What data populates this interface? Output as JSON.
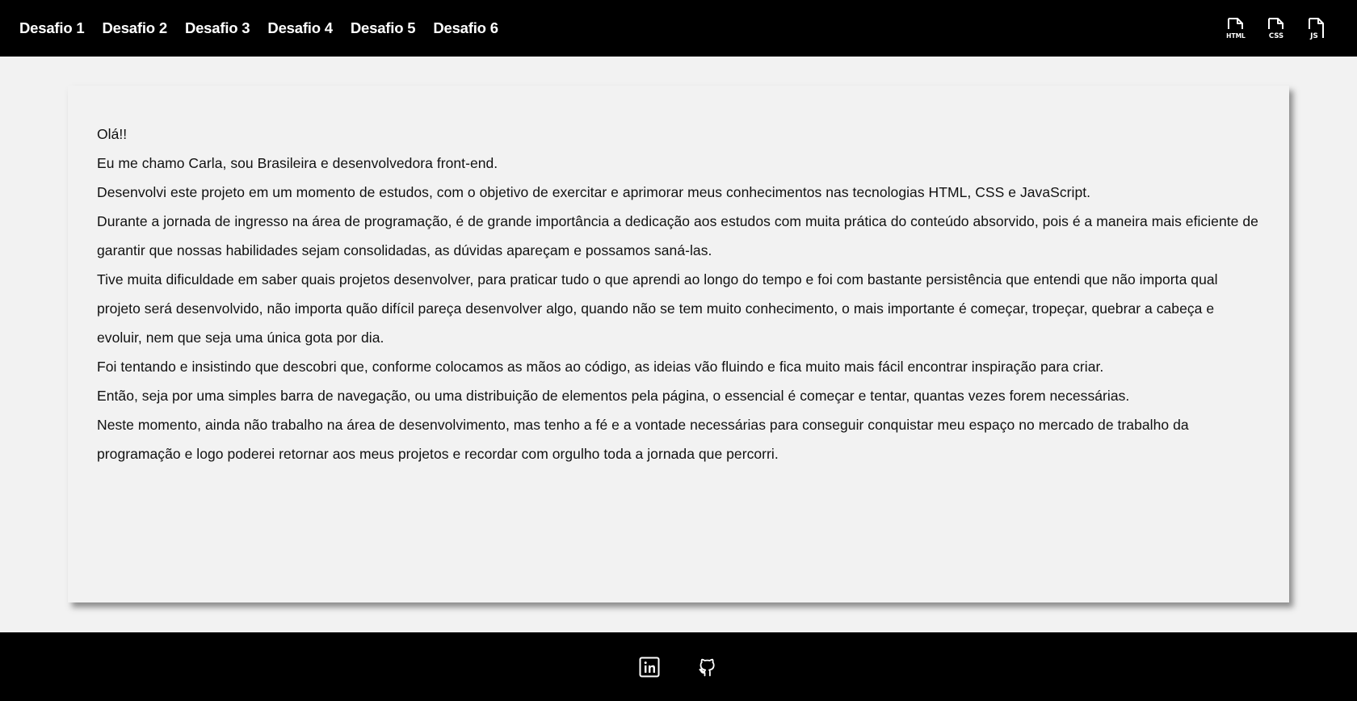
{
  "nav": {
    "items": [
      {
        "label": "Desafio 1"
      },
      {
        "label": "Desafio 2"
      },
      {
        "label": "Desafio 3"
      },
      {
        "label": "Desafio 4"
      },
      {
        "label": "Desafio 5"
      },
      {
        "label": "Desafio 6"
      }
    ]
  },
  "filetypes": [
    {
      "label": "HTML",
      "icon": "html-file-icon"
    },
    {
      "label": "CSS",
      "icon": "css-file-icon"
    },
    {
      "label": "JS",
      "icon": "js-file-icon"
    }
  ],
  "about": {
    "paragraphs": [
      "Olá!!",
      "Eu me chamo Carla, sou Brasileira e desenvolvedora front-end.",
      "Desenvolvi este projeto em um momento de estudos, com o objetivo de exercitar e aprimorar meus conhecimentos nas tecnologias HTML, CSS e JavaScript.",
      "Durante a jornada de ingresso na área de programação, é de grande importância a dedicação aos estudos com muita prática do conteúdo absorvido, pois é a maneira mais eficiente de garantir que nossas habilidades sejam consolidadas, as dúvidas apareçam e possamos saná-las.",
      "Tive muita dificuldade em saber quais projetos desenvolver, para praticar tudo o que aprendi ao longo do tempo e foi com bastante persistência que entendi que não importa qual projeto será desenvolvido, não importa quão difícil pareça desenvolver algo, quando não se tem muito conhecimento, o mais importante é começar, tropeçar, quebrar a cabeça e evoluir, nem que seja uma única gota por dia.",
      "Foi tentando e insistindo que descobri que, conforme colocamos as mãos ao código, as ideias vão fluindo e fica muito mais fácil encontrar inspiração para criar.",
      "Então, seja por uma simples barra de navegação, ou uma distribuição de elementos pela página, o essencial é começar e tentar, quantas vezes forem necessárias.",
      "Neste momento, ainda não trabalho na área de desenvolvimento, mas tenho a fé e a vontade necessárias para conseguir conquistar meu espaço no mercado de trabalho da programação e logo poderei retornar aos meus projetos e recordar com orgulho toda a jornada que percorri."
    ]
  },
  "footer": {
    "links": [
      {
        "icon": "linkedin-icon"
      },
      {
        "icon": "github-icon"
      }
    ]
  },
  "colors": {
    "bar_background": "#000000",
    "page_background": "#f2f2f2",
    "text": "#111111",
    "icon": "#ffffff"
  }
}
